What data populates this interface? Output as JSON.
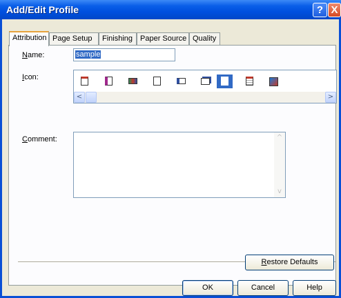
{
  "window": {
    "title": "Add/Edit Profile",
    "help_label": "?",
    "close_label": "X"
  },
  "tabs": [
    {
      "label": "Attribution",
      "active": true
    },
    {
      "label": "Page Setup",
      "active": false
    },
    {
      "label": "Finishing",
      "active": false
    },
    {
      "label": "Paper Source",
      "active": false
    },
    {
      "label": "Quality",
      "active": false
    }
  ],
  "form": {
    "name_label_key": "N",
    "name_label_rest": "ame:",
    "name_value": "sample",
    "icon_label_key": "I",
    "icon_label_rest": "con:",
    "comment_label_key": "C",
    "comment_label_rest": "omment:",
    "comment_value": ""
  },
  "icons": [
    {
      "name": "portrait-page-icon",
      "selected": false,
      "accent": "#c0392b"
    },
    {
      "name": "booklet-page-icon",
      "selected": false,
      "accent": "#a0288c"
    },
    {
      "name": "color-page-icon",
      "selected": false,
      "accent": "#2e8b57"
    },
    {
      "name": "plain-page-icon",
      "selected": false,
      "accent": "#555555"
    },
    {
      "name": "multi-page-icon",
      "selected": false,
      "accent": "#3050a0"
    },
    {
      "name": "stacked-pages-icon",
      "selected": false,
      "accent": "#3050a0"
    },
    {
      "name": "a4-page-icon",
      "selected": true,
      "accent": "#ffffff"
    },
    {
      "name": "text-page-icon",
      "selected": false,
      "accent": "#c0392b"
    },
    {
      "name": "color-graphic-icon",
      "selected": false,
      "accent": "#1e7ad6"
    }
  ],
  "buttons": {
    "restore_key": "R",
    "restore_rest": "estore Defaults",
    "ok": "OK",
    "cancel": "Cancel",
    "help": "Help"
  },
  "scroll": {
    "left_arrow": "<",
    "right_arrow": ">",
    "up_arrow": "^",
    "down_arrow": "v"
  }
}
